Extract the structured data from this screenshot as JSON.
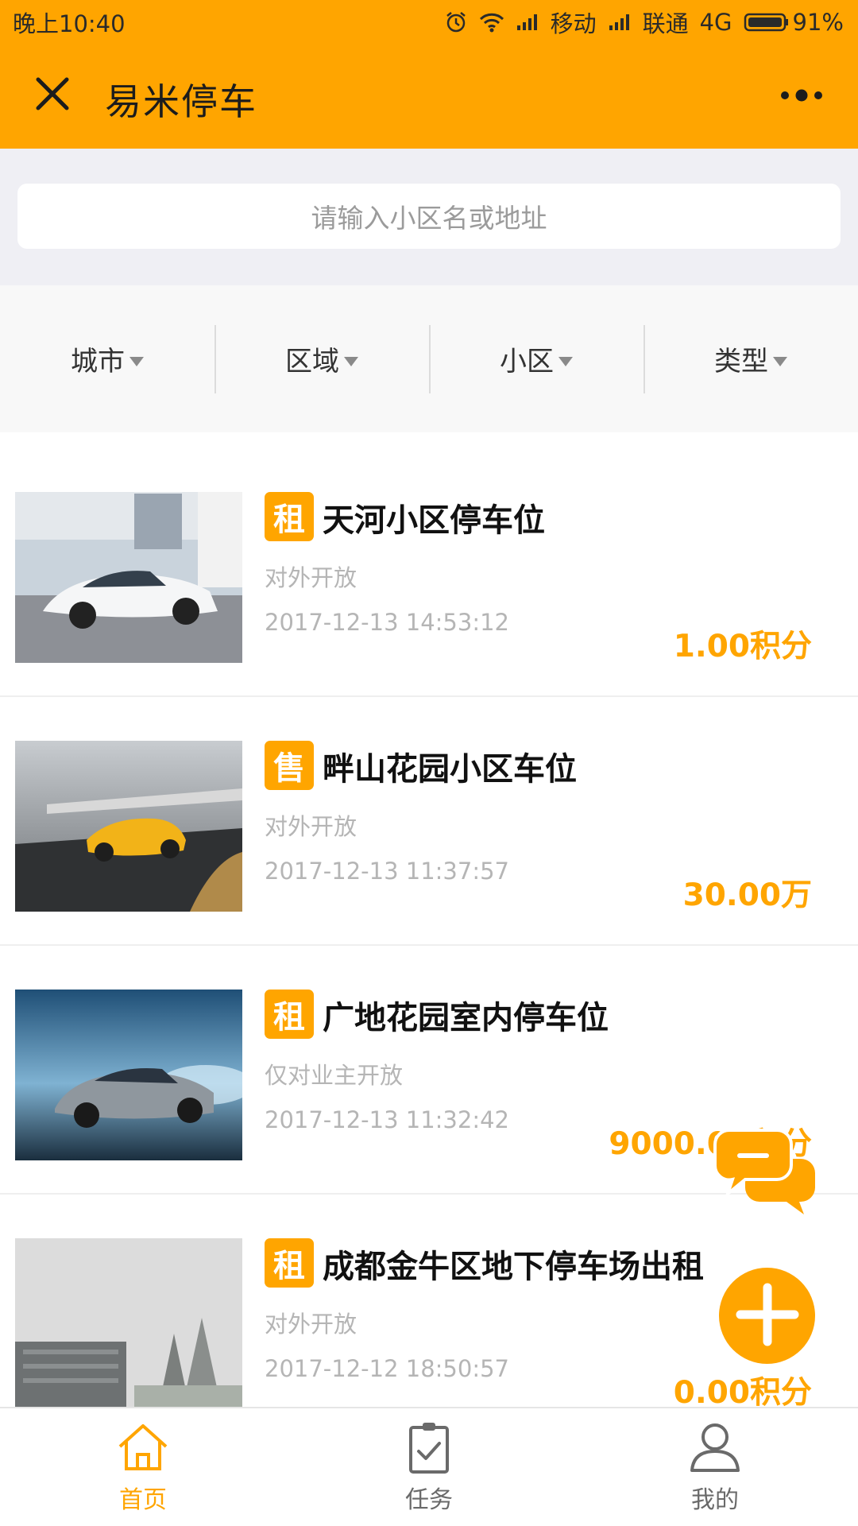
{
  "status_bar": {
    "time": "晚上10:40",
    "carrier1": "移动",
    "carrier2": "联通",
    "network": "4G",
    "battery": "91%",
    "icons": [
      "alarm-icon",
      "wifi-icon",
      "signal-icon",
      "signal-icon",
      "battery-icon"
    ]
  },
  "nav": {
    "title": "易米停车",
    "icons": [
      "close-icon",
      "more-icon"
    ]
  },
  "search": {
    "placeholder": "请输入小区名或地址"
  },
  "filters": [
    {
      "label": "城市"
    },
    {
      "label": "区域"
    },
    {
      "label": "小区"
    },
    {
      "label": "类型"
    }
  ],
  "listings": [
    {
      "tag": "租",
      "title": "天河小区停车位",
      "access": "对外开放",
      "time": "2017-12-13 14:53:12",
      "price": "1.00积分"
    },
    {
      "tag": "售",
      "title": "畔山花园小区车位",
      "access": "对外开放",
      "time": "2017-12-13 11:37:57",
      "price": "30.00万"
    },
    {
      "tag": "租",
      "title": "广地花园室内停车位",
      "access": "仅对业主开放",
      "time": "2017-12-13 11:32:42",
      "price": "9000.00积分"
    },
    {
      "tag": "租",
      "title": "成都金牛区地下停车场出租",
      "access": "对外开放",
      "time": "2017-12-12 18:50:57",
      "price": "0.00积分"
    }
  ],
  "tabs": [
    {
      "label": "首页",
      "icon": "home-icon",
      "active": true
    },
    {
      "label": "任务",
      "icon": "clipboard-icon",
      "active": false
    },
    {
      "label": "我的",
      "icon": "user-icon",
      "active": false
    }
  ],
  "colors": {
    "brand": "#FFA500",
    "text_muted": "#B5B5B5"
  }
}
